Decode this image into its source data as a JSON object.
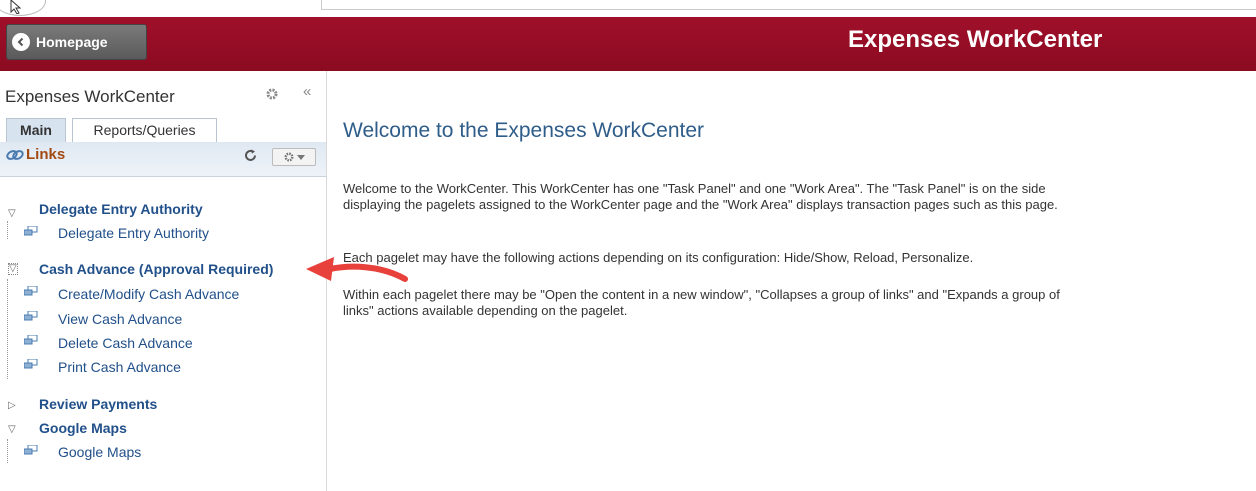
{
  "header": {
    "home_label": "Homepage",
    "title": "Expenses WorkCenter",
    "color": "#9b0f27"
  },
  "panel": {
    "title": "Expenses WorkCenter",
    "tabs": [
      {
        "label": "Main",
        "active": true
      },
      {
        "label": "Reports/Queries",
        "active": false
      }
    ],
    "links_label": "Links",
    "groups": [
      {
        "label": "Delegate Entry Authority",
        "expanded": true,
        "items": [
          "Delegate Entry Authority"
        ]
      },
      {
        "label": "Cash Advance (Approval Required)",
        "expanded": true,
        "items": [
          "Create/Modify Cash Advance",
          "View Cash Advance",
          "Delete Cash Advance",
          "Print Cash Advance"
        ]
      },
      {
        "label": "Review Payments",
        "expanded": false,
        "items": []
      },
      {
        "label": "Google Maps",
        "expanded": true,
        "items": [
          "Google Maps"
        ]
      }
    ]
  },
  "main": {
    "title": "Welcome to the Expenses WorkCenter",
    "paragraphs": [
      "Welcome to the WorkCenter. This WorkCenter has one \"Task Panel\" and one \"Work Area\". The \"Task Panel\" is on the side displaying the pagelets assigned to the WorkCenter page and the \"Work Area\" displays transaction pages such as this page.",
      "Each pagelet may have the following actions depending on its configuration: Hide/Show, Reload, Personalize.",
      "Within each pagelet there may be \"Open the content in a new window\", \"Collapses a group of links\" and \"Expands a group of links\" actions available depending on the pagelet."
    ]
  },
  "annotation": {
    "arrow_color": "#e8413c"
  }
}
